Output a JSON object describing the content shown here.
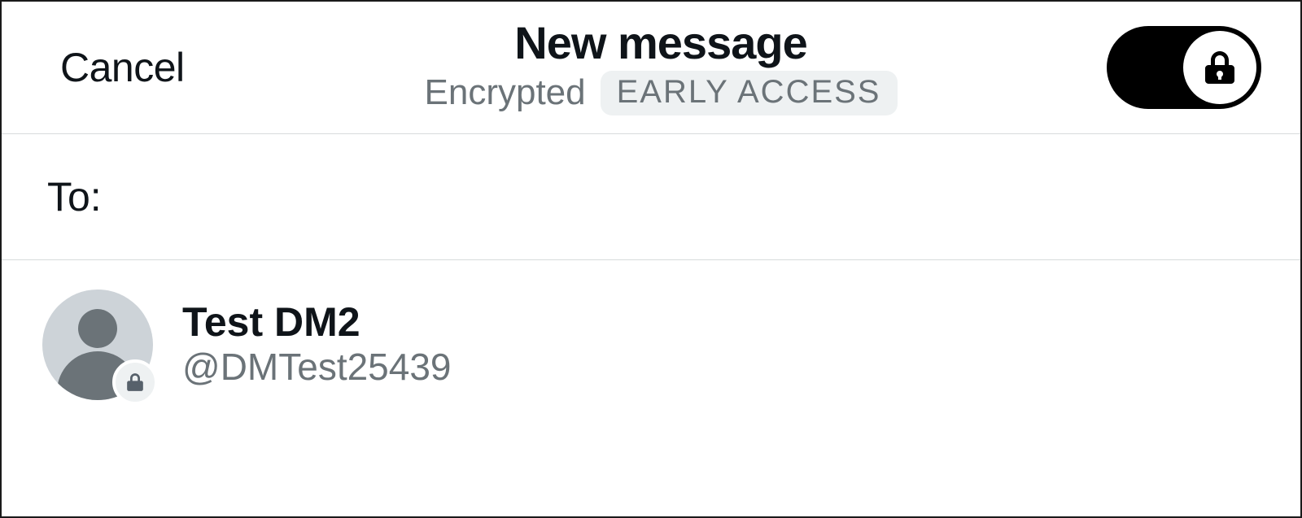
{
  "header": {
    "cancel_label": "Cancel",
    "title": "New message",
    "encrypted_label": "Encrypted",
    "badge": "EARLY ACCESS"
  },
  "to": {
    "label": "To:",
    "value": ""
  },
  "contacts": [
    {
      "name": "Test DM2",
      "handle": "@DMTest25439"
    }
  ],
  "icons": {
    "lock": "lock-icon",
    "silhouette": "person-silhouette-icon"
  }
}
